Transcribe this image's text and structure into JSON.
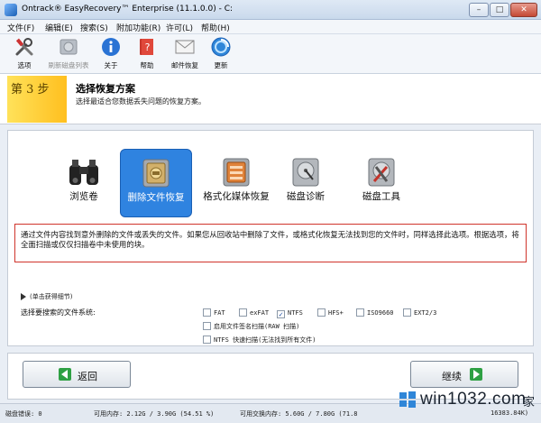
{
  "window": {
    "title": "Ontrack® EasyRecovery™ Enterprise (11.1.0.0) - C:"
  },
  "menu": {
    "items": [
      {
        "label": "文件(F)"
      },
      {
        "label": "编辑(E)"
      },
      {
        "label": "搜索(S)"
      },
      {
        "label": "附加功能(R)"
      },
      {
        "label": "许可(L)"
      },
      {
        "label": "帮助(H)"
      }
    ]
  },
  "toolbar": {
    "items": [
      {
        "label": "选项",
        "icon": "tools-icon",
        "enabled": true
      },
      {
        "label": "刷新磁盘列表",
        "icon": "disk-icon",
        "enabled": false
      },
      {
        "label": "关于",
        "icon": "info-icon",
        "enabled": true
      },
      {
        "label": "帮助",
        "icon": "help-book-icon",
        "enabled": true
      },
      {
        "label": "邮件恢复",
        "icon": "mail-icon",
        "enabled": true
      },
      {
        "label": "更新",
        "icon": "update-icon",
        "enabled": true
      }
    ]
  },
  "step": {
    "label": "第 3 步",
    "title": "选择恢复方案",
    "subtitle": "选择最适合您数据丢失问题的恢复方案。"
  },
  "options": [
    {
      "label": "浏览卷",
      "icon": "binoculars-icon",
      "selected": false
    },
    {
      "label": "删除文件恢复",
      "icon": "deleted-file-recovery-icon",
      "selected": true
    },
    {
      "label": "格式化媒体恢复",
      "icon": "format-recovery-icon",
      "selected": false
    },
    {
      "label": "磁盘诊断",
      "icon": "disk-diagnostics-icon",
      "selected": false
    },
    {
      "label": "磁盘工具",
      "icon": "disk-tools-icon",
      "selected": false
    }
  ],
  "description": "通过文件内容找到意外删除的文件或丢失的文件。如果您从回收站中删除了文件，或格式化恢复无法找到您的文件时，同样选择此选项。根据选项，将全面扫描或仅仅扫描卷中未使用的块。",
  "advanced": {
    "toggle_label": "(单击获得细节)",
    "fs_label": "选择要搜索的文件系统:",
    "filesystems": [
      {
        "label": "FAT",
        "checked": false
      },
      {
        "label": "exFAT",
        "checked": false
      },
      {
        "label": "NTFS",
        "checked": true
      },
      {
        "label": "HFS+",
        "checked": false
      },
      {
        "label": "ISO9660",
        "checked": false
      },
      {
        "label": "EXT2/3",
        "checked": false
      }
    ],
    "raw_scan": {
      "label": "启用文件签名扫描(RAW 扫描)",
      "checked": false
    },
    "ntfs_quick": {
      "label": "NTFS 快速扫描(无法找到所有文件)",
      "checked": false
    }
  },
  "nav": {
    "back_label": "返回",
    "next_label": "继续"
  },
  "status": {
    "disk_errors": "磁盘错误: 0",
    "memory": "可用内存: 2.12G / 3.90G (54.51 %)",
    "swap": "可用交换内存: 5.60G / 7.80G (71.8",
    "extra": "16383.84K)"
  },
  "watermark": {
    "text": "win1032.com",
    "suffix": "家"
  },
  "colors": {
    "selected": "#2f83e0",
    "step_yellow": "#ffcf30",
    "desc_border": "#d0342c",
    "arrow_green": "#2ea043"
  }
}
